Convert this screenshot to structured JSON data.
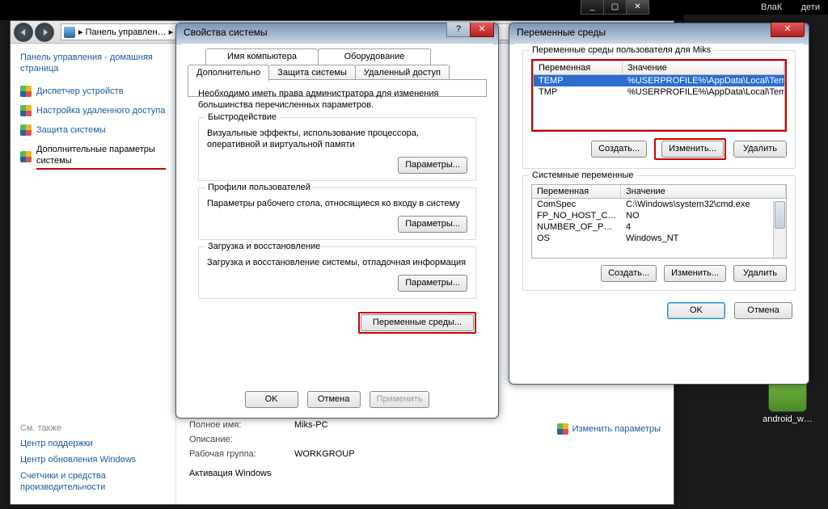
{
  "topbar": {
    "user1": "ВлаК",
    "user2": "дети"
  },
  "desktop_icon": "android_w…",
  "black_window": {
    "min": "_",
    "max": "▢",
    "close": "✕"
  },
  "cp": {
    "breadcrumb": "Панель управлен…",
    "sidebar": {
      "heading": "Панель управления - домашняя страница",
      "links": [
        "Диспетчер устройств",
        "Настройка удаленного доступа",
        "Защита системы",
        "Дополнительные параметры системы"
      ],
      "see_also": "См. также",
      "bottom": [
        "Центр поддержки",
        "Центр обновления Windows",
        "Счетчики и средства производительности"
      ]
    },
    "main": {
      "name_lbl": "Полное имя:",
      "name_val": "Miks-PC",
      "desc_lbl": "Описание:",
      "wg_lbl": "Рабочая группа:",
      "wg_val": "WORKGROUP",
      "activation": "Активация Windows",
      "change_params": "Изменить параметры"
    }
  },
  "sysprops": {
    "title": "Свойства системы",
    "tabs_row1": [
      "Имя компьютера",
      "Оборудование"
    ],
    "tabs_row2": [
      "Дополнительно",
      "Защита системы",
      "Удаленный доступ"
    ],
    "intro": "Необходимо иметь права администратора для изменения большинства перечисленных параметров.",
    "group1": {
      "lbl": "Быстродействие",
      "desc": "Визуальные эффекты, использование процессора, оперативной и виртуальной памяти",
      "btn": "Параметры..."
    },
    "group2": {
      "lbl": "Профили пользователей",
      "desc": "Параметры рабочего стола, относящиеся ко входу в систему",
      "btn": "Параметры..."
    },
    "group3": {
      "lbl": "Загрузка и восстановление",
      "desc": "Загрузка и восстановление системы, отладочная информация",
      "btn": "Параметры..."
    },
    "envvars_btn": "Переменные среды...",
    "ok": "OK",
    "cancel": "Отмена",
    "apply": "Применить"
  },
  "env": {
    "title": "Переменные среды",
    "user_lbl": "Переменные среды пользователя для Miks",
    "sys_lbl": "Системные переменные",
    "col1": "Переменная",
    "col2": "Значение",
    "user_rows": [
      {
        "k": "TEMP",
        "v": "%USERPROFILE%\\AppData\\Local\\Temp"
      },
      {
        "k": "TMP",
        "v": "%USERPROFILE%\\AppData\\Local\\Temp"
      }
    ],
    "sys_rows": [
      {
        "k": "ComSpec",
        "v": "C:\\Windows\\system32\\cmd.exe"
      },
      {
        "k": "FP_NO_HOST_C…",
        "v": "NO"
      },
      {
        "k": "NUMBER_OF_P…",
        "v": "4"
      },
      {
        "k": "OS",
        "v": "Windows_NT"
      }
    ],
    "create": "Создать...",
    "edit": "Изменить...",
    "delete": "Удалить",
    "ok": "OK",
    "cancel": "Отмена"
  }
}
